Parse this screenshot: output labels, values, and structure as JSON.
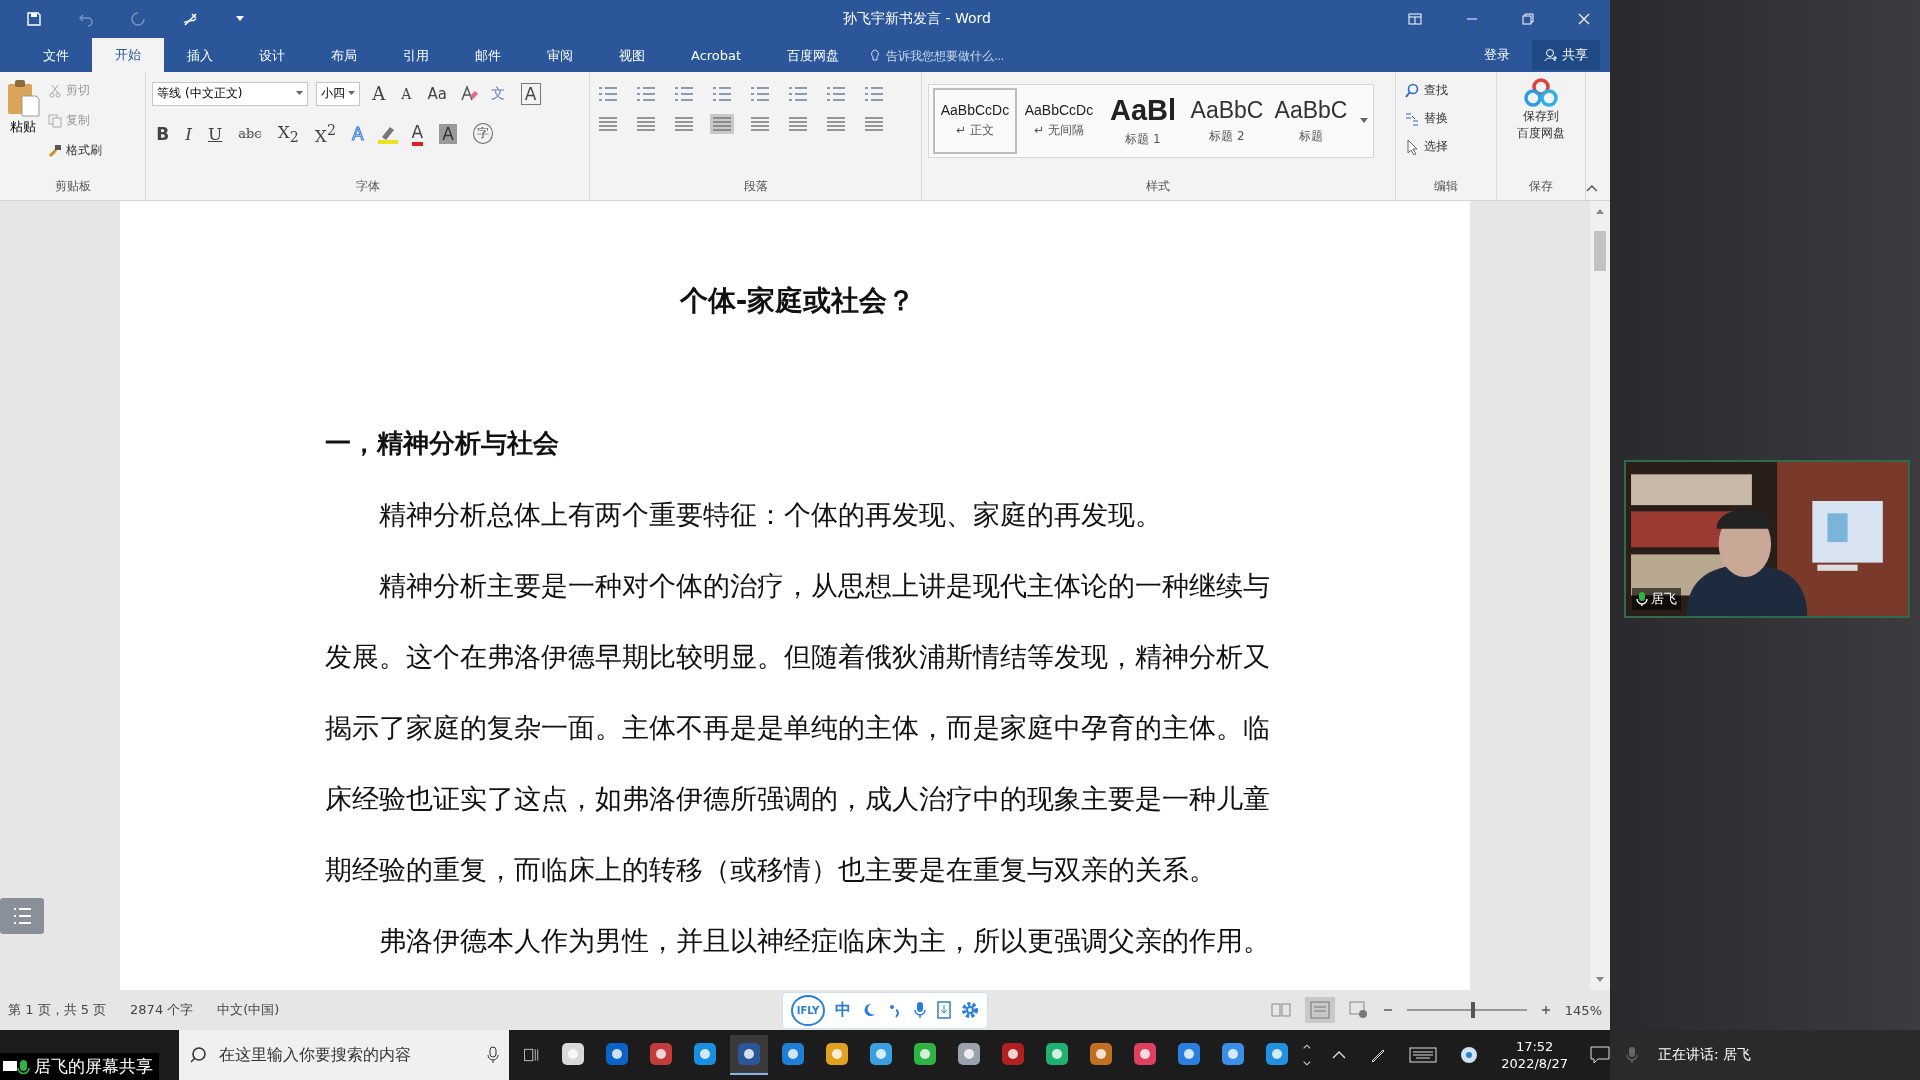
{
  "window": {
    "title": "孙飞宇新书发言 - Word"
  },
  "tabs": [
    {
      "label": "文件",
      "selected": false
    },
    {
      "label": "开始",
      "selected": true
    },
    {
      "label": "插入",
      "selected": false
    },
    {
      "label": "设计",
      "selected": false
    },
    {
      "label": "布局",
      "selected": false
    },
    {
      "label": "引用",
      "selected": false
    },
    {
      "label": "邮件",
      "selected": false
    },
    {
      "label": "审阅",
      "selected": false
    },
    {
      "label": "视图",
      "selected": false
    },
    {
      "label": "Acrobat",
      "selected": false
    },
    {
      "label": "百度网盘",
      "selected": false
    }
  ],
  "tell_me": {
    "placeholder": "告诉我您想要做什么..."
  },
  "account": {
    "sign_in": "登录",
    "share": "共享"
  },
  "ribbon": {
    "clipboard": {
      "paste": "粘贴",
      "cut": "剪切",
      "copy": "复制",
      "format_painter": "格式刷",
      "label": "剪贴板"
    },
    "font": {
      "font_name": "等线 (中文正文)",
      "font_size": "小四",
      "row1": [
        {
          "text": "A",
          "kind": "grow"
        },
        {
          "text": "A",
          "kind": "shrink"
        },
        {
          "text": "Aa",
          "kind": "case"
        },
        {
          "kind": "clear"
        },
        {
          "text": "文",
          "kind": "phonetic"
        },
        {
          "text": "A",
          "kind": "boxed"
        }
      ],
      "row2": [
        {
          "text": "B",
          "kind": "bold"
        },
        {
          "text": "I",
          "kind": "italic"
        },
        {
          "text": "U",
          "kind": "underline"
        },
        {
          "text": "abc",
          "kind": "strike"
        },
        {
          "text": "X$_{2}$",
          "kind": "plain"
        },
        {
          "text": "X$^{2}$",
          "kind": "plain"
        },
        {
          "text": "A",
          "kind": "effect"
        },
        {
          "kind": "highlight"
        },
        {
          "text": "A",
          "kind": "color"
        },
        {
          "text": "A",
          "kind": "shaded"
        },
        {
          "text": "字",
          "kind": "enclosed"
        }
      ],
      "label": "字体"
    },
    "paragraph": {
      "label": "段落"
    },
    "styles": {
      "items": [
        {
          "sample": "AaBbCcDc",
          "name": "↵ 正文",
          "kind": "body",
          "selected": true
        },
        {
          "sample": "AaBbCcDc",
          "name": "↵ 无间隔",
          "kind": "body",
          "selected": false
        },
        {
          "sample": "AaBl",
          "name": "标题 1",
          "kind": "heading1",
          "selected": false
        },
        {
          "sample": "AaBbC",
          "name": "标题 2",
          "kind": "heading2",
          "selected": false
        },
        {
          "sample": "AaBbC",
          "name": "标题",
          "kind": "heading2",
          "selected": false
        }
      ],
      "label": "样式"
    },
    "editing": {
      "find": "查找",
      "replace": "替换",
      "select": "选择",
      "label": "编辑"
    },
    "save": {
      "button": [
        "保存到",
        "百度网盘"
      ],
      "label": "保存"
    }
  },
  "document": {
    "title": "个体-家庭或社会？",
    "heading": "一，精神分析与社会",
    "paragraphs": [
      "精神分析总体上有两个重要特征：个体的再发现、家庭的再发现。",
      "精神分析主要是一种对个体的治疗，从思想上讲是现代主体论的一种继续与发展。这个在弗洛伊德早期比较明显。但随着俄狄浦斯情结等发现，精神分析又揭示了家庭的复杂一面。主体不再是是单纯的主体，而是家庭中孕育的主体。临床经验也证实了这点，如弗洛伊德所强调的，成人治疗中的现象主要是一种儿童期经验的重复，而临床上的转移（或移情）也主要是在重复与双亲的关系。",
      "弗洛伊德本人作为男性，并且以神经症临床为主，所以更强调父亲的作用。"
    ]
  },
  "status_bar": {
    "page": "第 1 页，共 5 页",
    "words": "2874 个字",
    "language": "中文(中国)",
    "ime": {
      "logo": "IFLY",
      "mode": "中"
    },
    "zoom": {
      "level": 0.55,
      "reading": "145%"
    }
  },
  "taskbar": {
    "search": {
      "placeholder": "在这里输入你要搜索的内容"
    },
    "time": "17:52",
    "date": "2022/8/27"
  },
  "screen_share": {
    "label": "居飞的屏幕共享"
  },
  "video": {
    "name": "居飞"
  },
  "speaking": "正在讲话: 居飞"
}
